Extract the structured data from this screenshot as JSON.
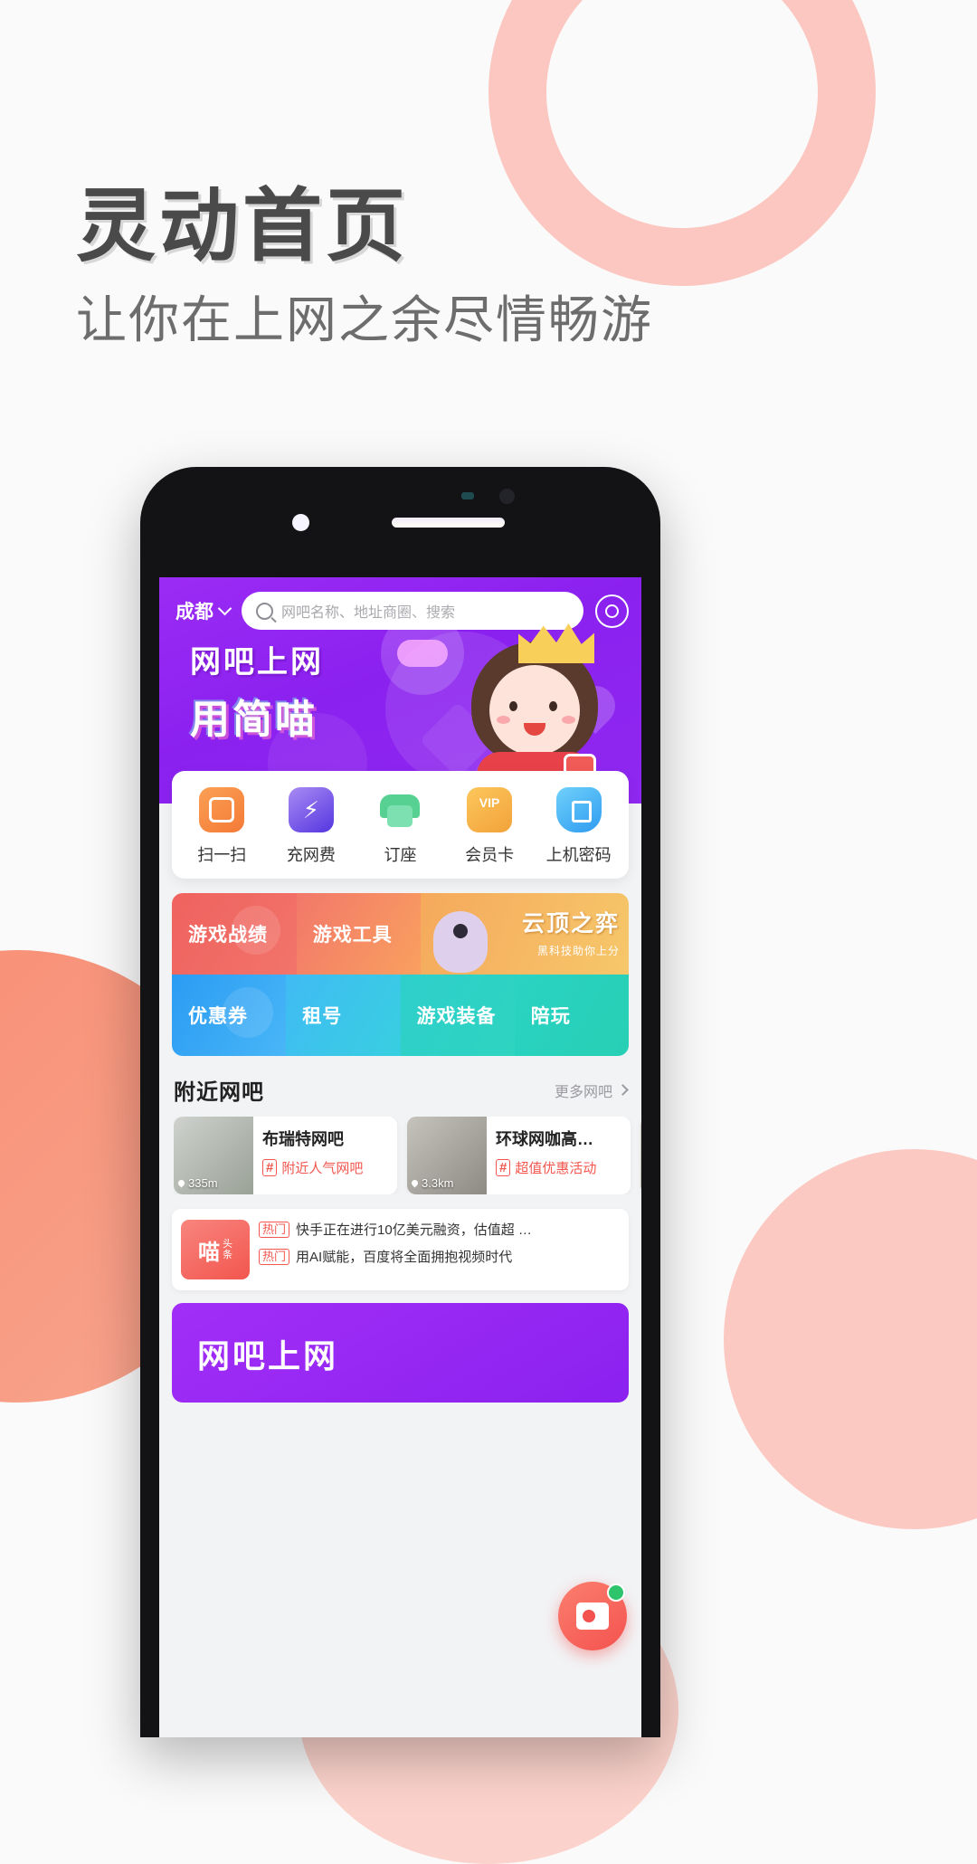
{
  "promo": {
    "title": "灵动首页",
    "subtitle": "让你在上网之余尽情畅游"
  },
  "app": {
    "header": {
      "city": "成都",
      "chevron_icon": "chevron-down-icon",
      "search_placeholder": "网吧名称、地址商圈、搜索",
      "search_icon": "search-icon",
      "location_icon": "location-target-icon"
    },
    "hero": {
      "line1": "网吧上网",
      "line2": "用简喵",
      "gamepad_icon": "gamepad-icon",
      "pin_icon": "map-pin-icon"
    },
    "quick_actions": [
      {
        "label": "扫一扫",
        "icon": "scan-icon"
      },
      {
        "label": "充网费",
        "icon": "lightning-laptop-icon"
      },
      {
        "label": "订座",
        "icon": "armchair-icon"
      },
      {
        "label": "会员卡",
        "icon": "vip-card-icon"
      },
      {
        "label": "上机密码",
        "icon": "shield-lock-icon"
      }
    ],
    "feature_grid": {
      "row1": [
        {
          "label": "游戏战绩",
          "icon": "trophy-icon"
        },
        {
          "label": "游戏工具",
          "icon": "tools-icon"
        },
        {
          "label": "云顶之弈",
          "sub": "黑科技助你上分",
          "icon": "tft-bird-icon"
        }
      ],
      "row2": [
        {
          "label": "优惠券",
          "icon": "coupon-icon"
        },
        {
          "label": "租号",
          "icon": "account-rent-icon"
        },
        {
          "label": "游戏装备",
          "icon": "gear-icon"
        },
        {
          "label": "陪玩",
          "icon": "companion-icon"
        }
      ]
    },
    "nearby": {
      "title": "附近网吧",
      "more_label": "更多网吧",
      "more_arrow_icon": "chevron-right-icon",
      "cafes": [
        {
          "name": "布瑞特网吧",
          "distance": "335m",
          "tag": "附近人气网吧",
          "hash": "#"
        },
        {
          "name": "环球网咖高…",
          "distance": "3.3km",
          "tag": "超值优惠活动",
          "hash": "#"
        },
        {
          "name": "",
          "distance": "",
          "tag": "",
          "hash": "#"
        }
      ]
    },
    "news": {
      "logo_main": "喵",
      "logo_sub_top": "头",
      "logo_sub_bottom": "条",
      "items": [
        {
          "badge": "热门",
          "badge_icon": "fire-icon",
          "text": "快手正在进行10亿美元融资，估值超 …"
        },
        {
          "badge": "热门",
          "badge_icon": "fire-icon",
          "text": "用AI赋能，百度将全面拥抱视频时代"
        }
      ]
    },
    "bottom_banner": {
      "text": "网吧上网"
    },
    "fab": {
      "icon": "service-card-icon",
      "badge_icon": "online-dot-icon"
    }
  },
  "colors": {
    "brand_purple": "#8b21ef",
    "accent_red": "#f2564e",
    "page_bg": "#fbfafa"
  }
}
